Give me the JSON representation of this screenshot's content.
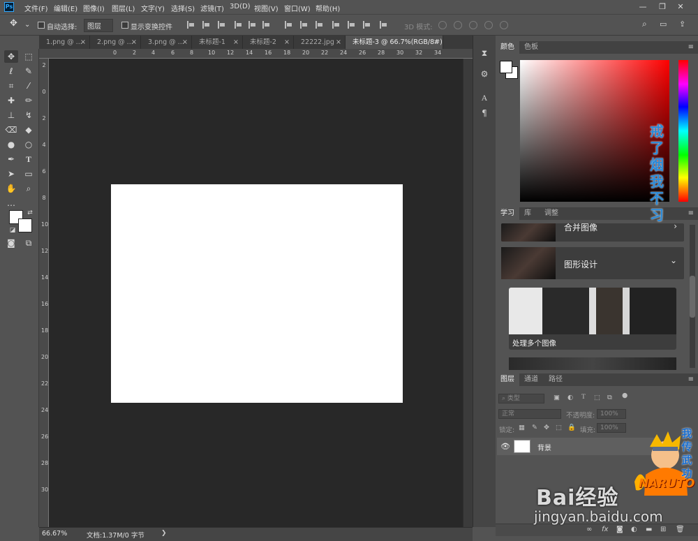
{
  "app": {
    "logo_text": "Ps"
  },
  "menu": [
    "文件(F)",
    "编辑(E)",
    "图像(I)",
    "图层(L)",
    "文字(Y)",
    "选择(S)",
    "滤镜(T)",
    "3D(D)",
    "视图(V)",
    "窗口(W)",
    "帮助(H)"
  ],
  "window_controls": {
    "minimize": "—",
    "restore": "❐",
    "close": "✕"
  },
  "options": {
    "auto_select_label": "自动选择:",
    "layer_dropdown_value": "图层",
    "show_transform_label": "显示变换控件",
    "mode_3d_label": "3D 模式:"
  },
  "tabs": [
    {
      "label": "1.png @ ...",
      "active": false
    },
    {
      "label": "2.png @ ...",
      "active": false
    },
    {
      "label": "3.png @ ...",
      "active": false
    },
    {
      "label": "未标题-1",
      "active": false
    },
    {
      "label": "未标题-2",
      "active": false
    },
    {
      "label": "22222.jpg",
      "active": false
    },
    {
      "label": "未标题-3 @ 66.7%(RGB/8#)",
      "active": true
    }
  ],
  "tab_close": "×",
  "rulers": {
    "top": [
      "0",
      "2",
      "4",
      "6",
      "8",
      "10",
      "12",
      "14",
      "16",
      "18",
      "20",
      "22",
      "24",
      "26",
      "28",
      "30",
      "32",
      "34"
    ],
    "left": [
      "2",
      "0",
      "2",
      "4",
      "6",
      "8",
      "10",
      "12",
      "14",
      "16",
      "18",
      "20",
      "22",
      "24",
      "26",
      "28",
      "30"
    ]
  },
  "status": {
    "zoom": "66.67%",
    "doc_info": "文档:1.37M/0 字节",
    "arrow": "❯"
  },
  "panels": {
    "color_tabs": [
      "颜色",
      "色板"
    ],
    "learn_tabs": [
      "学习",
      "库",
      "调整"
    ],
    "layers_tabs": [
      "图层",
      "通道",
      "路径"
    ],
    "menu_icon": "≡"
  },
  "learn": {
    "items": [
      {
        "title": "合并图像",
        "chevron": "›"
      },
      {
        "title": "图形设计",
        "chevron": "⌄"
      }
    ],
    "card_caption": "处理多个图像"
  },
  "layers": {
    "filter_label": "类型",
    "blend_mode": "正常",
    "opacity_label": "不透明度:",
    "opacity_value": "100%",
    "lock_label": "锁定:",
    "fill_label": "填充:",
    "fill_value": "100%",
    "items": [
      {
        "name": "背景",
        "visible": true
      }
    ]
  },
  "watermarks": {
    "vertical_text": "戒了烟我不习惯",
    "baidu": "Bai经验",
    "baidu_url": "jingyan.baidu.com",
    "naruto_logo": "NARUTO",
    "naruto_side": "我传武功"
  }
}
